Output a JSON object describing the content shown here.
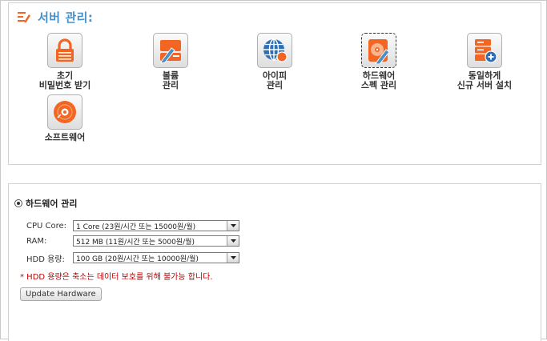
{
  "header": {
    "title": "서버 관리:"
  },
  "tiles": [
    {
      "label": "초기\n비밀번호 받기",
      "icon": "lock-icon"
    },
    {
      "label": "볼륨\n관리",
      "icon": "volume-icon"
    },
    {
      "label": "아이피\n관리",
      "icon": "globe-icon"
    },
    {
      "label": "하드웨어\n스펙 관리",
      "icon": "hdd-icon"
    },
    {
      "label": "동일하게\n신규 서버 설치",
      "icon": "server-add-icon"
    },
    {
      "label": "소프트웨어",
      "icon": "disc-icon"
    }
  ],
  "hardware": {
    "section_title": "하드웨어 관리",
    "fields": [
      {
        "label": "CPU Core:",
        "value": "1 Core (23원/시간 또는 15000원/월)"
      },
      {
        "label": "RAM:",
        "value": "512 MB (11원/시간 또는 5000원/월)"
      },
      {
        "label": "HDD 용량:",
        "value": "100 GB (20원/시간 또는 10000원/월)"
      }
    ],
    "notice": "* HDD 용량은 축소는 데이터 보호를 위해 불가능 합니다.",
    "update_button": "Update Hardware"
  },
  "colors": {
    "accent": "#4a90c8",
    "orange": "#f26522",
    "warning": "#c00000"
  }
}
